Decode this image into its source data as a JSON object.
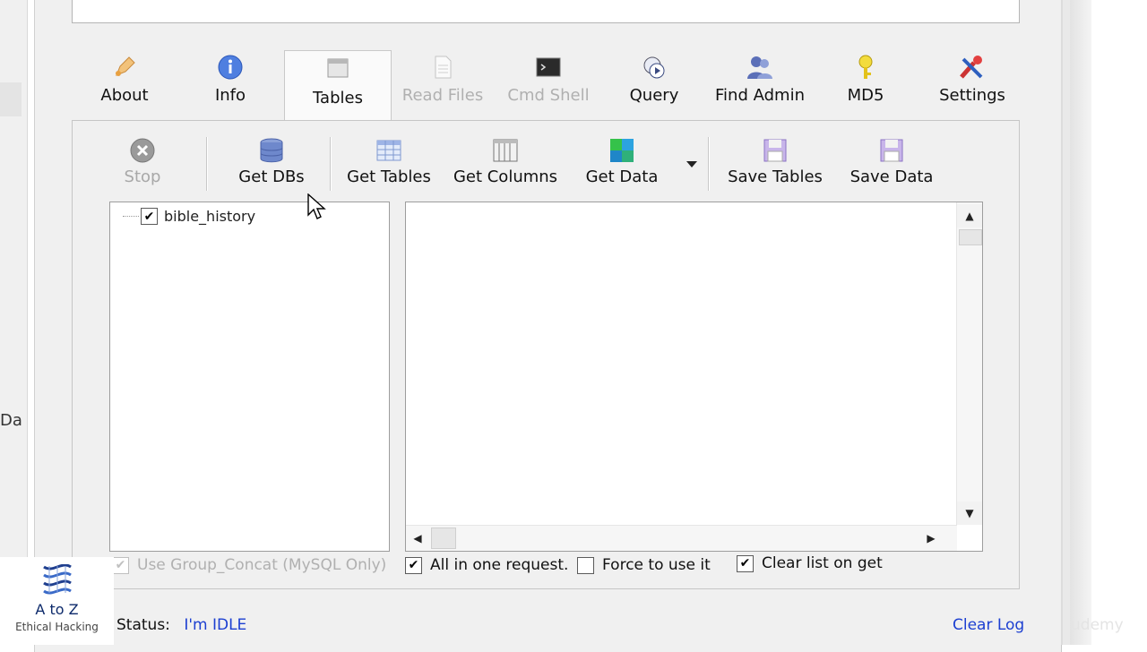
{
  "tabs": [
    {
      "label": "About",
      "icon": "pen-icon",
      "state": "normal"
    },
    {
      "label": "Info",
      "icon": "info-icon",
      "state": "normal"
    },
    {
      "label": "Tables",
      "icon": "table-window-icon",
      "state": "selected"
    },
    {
      "label": "Read Files",
      "icon": "file-icon",
      "state": "disabled"
    },
    {
      "label": "Cmd Shell",
      "icon": "terminal-icon",
      "state": "disabled"
    },
    {
      "label": "Query",
      "icon": "query-icon",
      "state": "normal"
    },
    {
      "label": "Find Admin",
      "icon": "users-icon",
      "state": "normal"
    },
    {
      "label": "MD5",
      "icon": "key-icon",
      "state": "normal"
    },
    {
      "label": "Settings",
      "icon": "tools-icon",
      "state": "normal"
    }
  ],
  "toolbar": {
    "stop_label": "Stop",
    "get_dbs_label": "Get DBs",
    "get_tables_label": "Get Tables",
    "get_columns_label": "Get Columns",
    "get_data_label": "Get Data",
    "save_tables_label": "Save Tables",
    "save_data_label": "Save Data"
  },
  "tree": {
    "items": [
      {
        "label": "bible_history",
        "checked": true
      }
    ]
  },
  "options": {
    "group_concat": {
      "label": "Use Group_Concat (MySQL Only)",
      "checked": true,
      "enabled": false
    },
    "all_in_one": {
      "label": "All in one request.",
      "checked": true
    },
    "force_use": {
      "label": "Force to use it",
      "checked": false
    },
    "clear_list": {
      "label": "Clear list on get",
      "checked": true
    }
  },
  "status": {
    "label": "Status:",
    "value": "I'm IDLE",
    "clear_log": "Clear Log"
  },
  "watermark": {
    "title": "A to Z",
    "subtitle": "Ethical Hacking"
  },
  "background": {
    "left_fragment": "Da",
    "corner_text": "udemy"
  },
  "colors": {
    "link": "#1c3fd1",
    "disabled_text": "#b0b0b0",
    "panel_bg": "#f0f0f0"
  }
}
